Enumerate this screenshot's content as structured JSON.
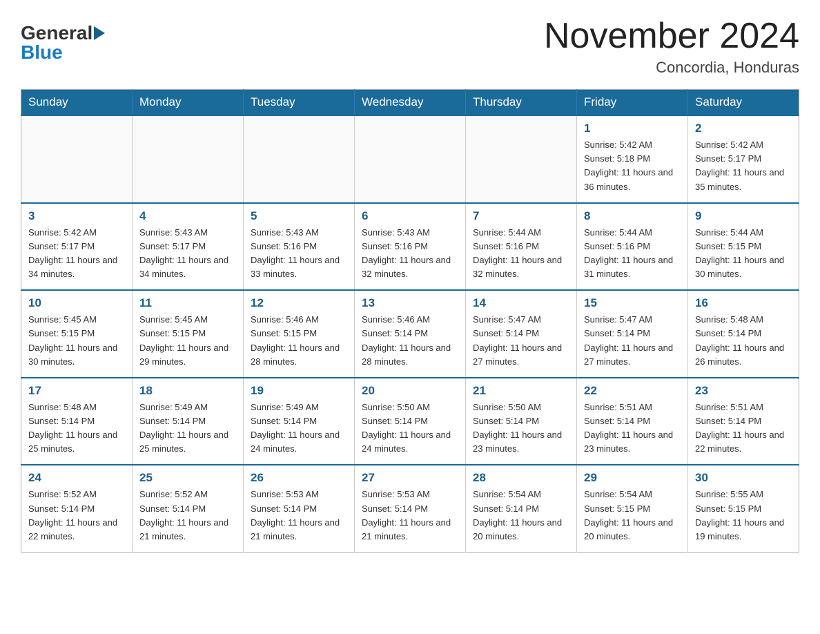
{
  "header": {
    "logo_general": "General",
    "logo_blue": "Blue",
    "month_title": "November 2024",
    "location": "Concordia, Honduras"
  },
  "weekdays": [
    "Sunday",
    "Monday",
    "Tuesday",
    "Wednesday",
    "Thursday",
    "Friday",
    "Saturday"
  ],
  "weeks": [
    [
      {
        "day": "",
        "info": ""
      },
      {
        "day": "",
        "info": ""
      },
      {
        "day": "",
        "info": ""
      },
      {
        "day": "",
        "info": ""
      },
      {
        "day": "",
        "info": ""
      },
      {
        "day": "1",
        "info": "Sunrise: 5:42 AM\nSunset: 5:18 PM\nDaylight: 11 hours and 36 minutes."
      },
      {
        "day": "2",
        "info": "Sunrise: 5:42 AM\nSunset: 5:17 PM\nDaylight: 11 hours and 35 minutes."
      }
    ],
    [
      {
        "day": "3",
        "info": "Sunrise: 5:42 AM\nSunset: 5:17 PM\nDaylight: 11 hours and 34 minutes."
      },
      {
        "day": "4",
        "info": "Sunrise: 5:43 AM\nSunset: 5:17 PM\nDaylight: 11 hours and 34 minutes."
      },
      {
        "day": "5",
        "info": "Sunrise: 5:43 AM\nSunset: 5:16 PM\nDaylight: 11 hours and 33 minutes."
      },
      {
        "day": "6",
        "info": "Sunrise: 5:43 AM\nSunset: 5:16 PM\nDaylight: 11 hours and 32 minutes."
      },
      {
        "day": "7",
        "info": "Sunrise: 5:44 AM\nSunset: 5:16 PM\nDaylight: 11 hours and 32 minutes."
      },
      {
        "day": "8",
        "info": "Sunrise: 5:44 AM\nSunset: 5:16 PM\nDaylight: 11 hours and 31 minutes."
      },
      {
        "day": "9",
        "info": "Sunrise: 5:44 AM\nSunset: 5:15 PM\nDaylight: 11 hours and 30 minutes."
      }
    ],
    [
      {
        "day": "10",
        "info": "Sunrise: 5:45 AM\nSunset: 5:15 PM\nDaylight: 11 hours and 30 minutes."
      },
      {
        "day": "11",
        "info": "Sunrise: 5:45 AM\nSunset: 5:15 PM\nDaylight: 11 hours and 29 minutes."
      },
      {
        "day": "12",
        "info": "Sunrise: 5:46 AM\nSunset: 5:15 PM\nDaylight: 11 hours and 28 minutes."
      },
      {
        "day": "13",
        "info": "Sunrise: 5:46 AM\nSunset: 5:14 PM\nDaylight: 11 hours and 28 minutes."
      },
      {
        "day": "14",
        "info": "Sunrise: 5:47 AM\nSunset: 5:14 PM\nDaylight: 11 hours and 27 minutes."
      },
      {
        "day": "15",
        "info": "Sunrise: 5:47 AM\nSunset: 5:14 PM\nDaylight: 11 hours and 27 minutes."
      },
      {
        "day": "16",
        "info": "Sunrise: 5:48 AM\nSunset: 5:14 PM\nDaylight: 11 hours and 26 minutes."
      }
    ],
    [
      {
        "day": "17",
        "info": "Sunrise: 5:48 AM\nSunset: 5:14 PM\nDaylight: 11 hours and 25 minutes."
      },
      {
        "day": "18",
        "info": "Sunrise: 5:49 AM\nSunset: 5:14 PM\nDaylight: 11 hours and 25 minutes."
      },
      {
        "day": "19",
        "info": "Sunrise: 5:49 AM\nSunset: 5:14 PM\nDaylight: 11 hours and 24 minutes."
      },
      {
        "day": "20",
        "info": "Sunrise: 5:50 AM\nSunset: 5:14 PM\nDaylight: 11 hours and 24 minutes."
      },
      {
        "day": "21",
        "info": "Sunrise: 5:50 AM\nSunset: 5:14 PM\nDaylight: 11 hours and 23 minutes."
      },
      {
        "day": "22",
        "info": "Sunrise: 5:51 AM\nSunset: 5:14 PM\nDaylight: 11 hours and 23 minutes."
      },
      {
        "day": "23",
        "info": "Sunrise: 5:51 AM\nSunset: 5:14 PM\nDaylight: 11 hours and 22 minutes."
      }
    ],
    [
      {
        "day": "24",
        "info": "Sunrise: 5:52 AM\nSunset: 5:14 PM\nDaylight: 11 hours and 22 minutes."
      },
      {
        "day": "25",
        "info": "Sunrise: 5:52 AM\nSunset: 5:14 PM\nDaylight: 11 hours and 21 minutes."
      },
      {
        "day": "26",
        "info": "Sunrise: 5:53 AM\nSunset: 5:14 PM\nDaylight: 11 hours and 21 minutes."
      },
      {
        "day": "27",
        "info": "Sunrise: 5:53 AM\nSunset: 5:14 PM\nDaylight: 11 hours and 21 minutes."
      },
      {
        "day": "28",
        "info": "Sunrise: 5:54 AM\nSunset: 5:14 PM\nDaylight: 11 hours and 20 minutes."
      },
      {
        "day": "29",
        "info": "Sunrise: 5:54 AM\nSunset: 5:15 PM\nDaylight: 11 hours and 20 minutes."
      },
      {
        "day": "30",
        "info": "Sunrise: 5:55 AM\nSunset: 5:15 PM\nDaylight: 11 hours and 19 minutes."
      }
    ]
  ]
}
